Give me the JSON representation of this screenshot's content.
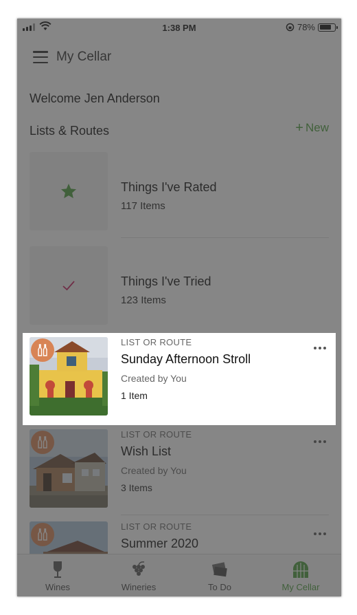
{
  "status_bar": {
    "time": "1:38 PM",
    "battery": "78%",
    "battery_level": 0.78
  },
  "header": {
    "title": "My Cellar"
  },
  "welcome": {
    "prefix": "Welcome",
    "name": "Jen Anderson"
  },
  "lists_section": {
    "title": "Lists & Routes",
    "new_label": "New"
  },
  "default_lists": [
    {
      "title": "Things I've Rated",
      "count": "117 Items",
      "icon": "star-icon"
    },
    {
      "title": "Things I've Tried",
      "count": "123 Items",
      "icon": "checkmark-icon"
    }
  ],
  "routes": [
    {
      "kicker": "LIST OR ROUTE",
      "title": "Sunday Afternoon Stroll",
      "creator": "Created by You",
      "count": "1 Item"
    },
    {
      "kicker": "LIST OR ROUTE",
      "title": "Wish List",
      "creator": "Created by You",
      "count": "3 Items"
    },
    {
      "kicker": "LIST OR ROUTE",
      "title": "Summer 2020",
      "creator": "",
      "count": ""
    }
  ],
  "tabs": [
    {
      "label": "Wines",
      "icon": "wine-glass-icon",
      "active": false
    },
    {
      "label": "Wineries",
      "icon": "grapes-icon",
      "active": false
    },
    {
      "label": "To Do",
      "icon": "tickets-icon",
      "active": false
    },
    {
      "label": "My Cellar",
      "icon": "cellar-icon",
      "active": true
    }
  ],
  "colors": {
    "accent": "#4a9b3c",
    "badge": "#d88455",
    "check": "#c2185b"
  }
}
